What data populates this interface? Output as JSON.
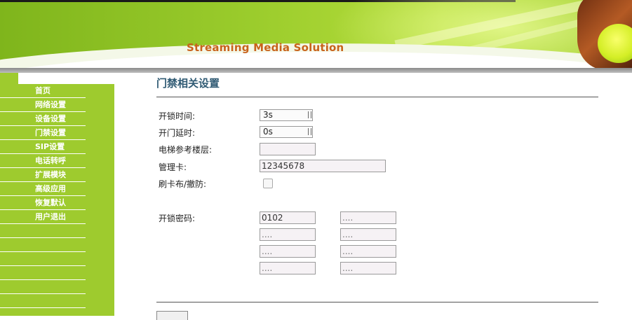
{
  "banner": {
    "title": "Streaming Media Solution"
  },
  "sidebar": {
    "items": [
      {
        "label": "首页"
      },
      {
        "label": "网络设置"
      },
      {
        "label": "设备设置"
      },
      {
        "label": "门禁设置"
      },
      {
        "label": "SIP设置"
      },
      {
        "label": "电话转呼"
      },
      {
        "label": "扩展模块"
      },
      {
        "label": "高级应用"
      },
      {
        "label": "恢复默认"
      },
      {
        "label": "用户退出"
      }
    ]
  },
  "main": {
    "section_title": "门禁相关设置",
    "unlock_time": {
      "label": "开锁时间:",
      "value": "3s"
    },
    "door_delay": {
      "label": "开门延时:",
      "value": "0s"
    },
    "elevator_floor": {
      "label": "电梯参考楼层:",
      "value": ""
    },
    "admin_card": {
      "label": "管理卡:",
      "value": "12345678"
    },
    "card_arm": {
      "label": "刷卡布/撤防:",
      "checked": false
    },
    "unlock_password": {
      "label": "开锁密码:",
      "fields": [
        "0102",
        "....",
        "....",
        "....",
        "....",
        "....",
        "....",
        "...."
      ]
    }
  },
  "colors": {
    "sidebar_bg": "#9ecb2e",
    "title_orange": "#c8621b",
    "section_title": "#2f5a73"
  }
}
